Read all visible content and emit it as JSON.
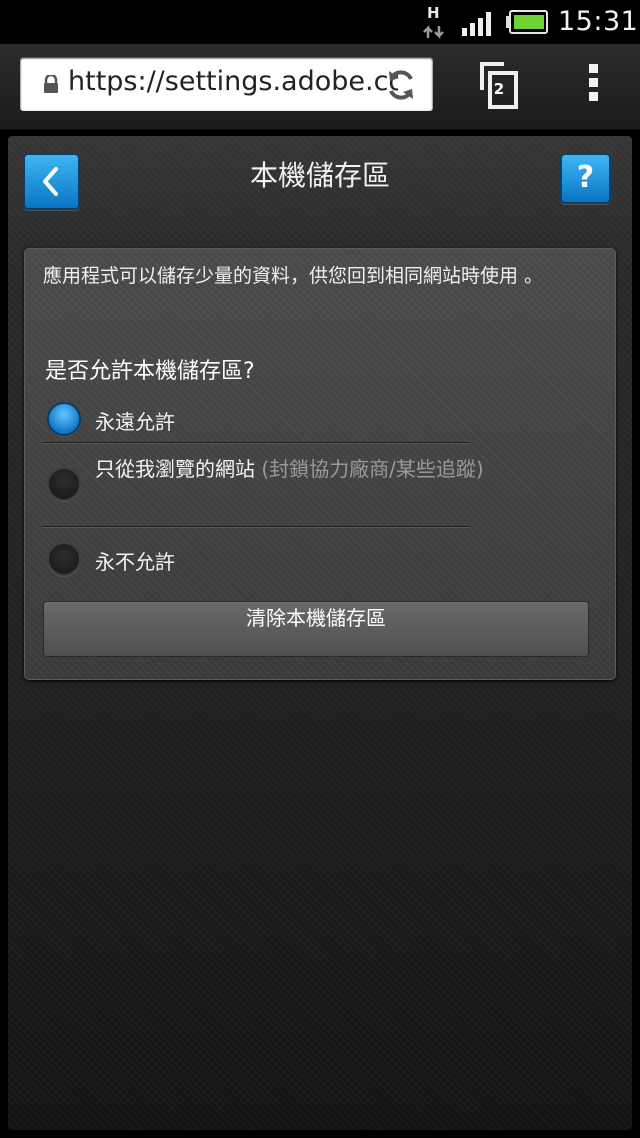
{
  "status_bar": {
    "network_type": "H",
    "time": "15:31",
    "icons": [
      "network-activity-icon",
      "signal-icon",
      "battery-icon"
    ]
  },
  "browser": {
    "url": "https://settings.adobe.co...",
    "tab_count": "2",
    "icons": [
      "lock-icon",
      "refresh-icon",
      "tabs-icon",
      "overflow-menu-icon"
    ]
  },
  "page": {
    "title": "本機儲存區",
    "back_icon": "chevron-left-icon",
    "help_label": "?",
    "description": "應用程式可以儲存少量的資料，供您回到相同網站時使用 。",
    "question": "是否允許本機儲存區?",
    "options": [
      {
        "label": "永遠允許",
        "note": "",
        "selected": true
      },
      {
        "label": "只從我瀏覽的網站",
        "note": "(封鎖協力廠商/某些追蹤)",
        "selected": false
      },
      {
        "label": "永不允許",
        "note": "",
        "selected": false
      }
    ],
    "clear_button": "清除本機儲存區"
  },
  "colors": {
    "accent_blue": "#1b8fd9",
    "battery_green": "#6ed436"
  }
}
